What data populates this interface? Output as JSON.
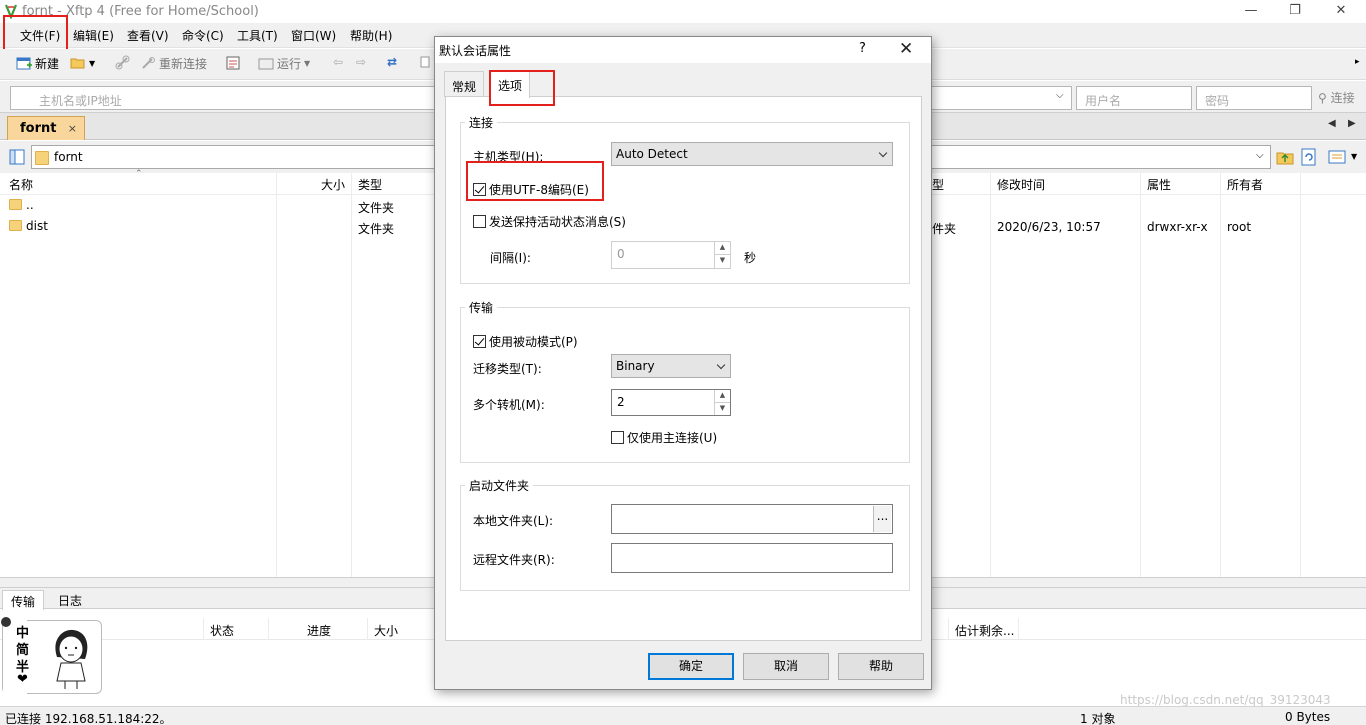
{
  "window": {
    "title": "fornt - Xftp 4 (Free for Home/School)",
    "controls": {
      "minimize": "—",
      "maximize": "❐",
      "close": "✕"
    }
  },
  "menu": [
    "文件(F)",
    "编辑(E)",
    "查看(V)",
    "命令(C)",
    "工具(T)",
    "窗口(W)",
    "帮助(H)"
  ],
  "toolbar": {
    "new": "新建",
    "reconnect": "重新连接",
    "run": "运行"
  },
  "address": {
    "host_placeholder": "主机名或IP地址",
    "user_placeholder": "用户名",
    "password_placeholder": "密码",
    "connect": "连接"
  },
  "session_tab": {
    "label": "fornt",
    "close": "×"
  },
  "path": "fornt",
  "left_pane": {
    "columns": [
      "名称",
      "大小",
      "类型"
    ],
    "rows": [
      {
        "name": "..",
        "size": "",
        "type": "文件夹"
      },
      {
        "name": "dist",
        "size": "",
        "type": "文件夹"
      }
    ]
  },
  "right_pane": {
    "columns": [
      "型",
      "修改时间",
      "属性",
      "所有者"
    ],
    "rows": [
      {
        "type": "件夹",
        "modified": "2020/6/23, 10:57",
        "attributes": "drwxr-xr-x",
        "owner": "root"
      }
    ]
  },
  "bottom_tabs": [
    "传输",
    "日志"
  ],
  "transfer_columns": [
    "状态",
    "进度",
    "大小",
    "估计剩余..."
  ],
  "sticker_chars": [
    "中",
    "简",
    "半",
    "❤"
  ],
  "status": {
    "connection": "已连接 192.168.51.184:22。",
    "objects": "1 对象",
    "bytes": "0 Bytes"
  },
  "watermark": "https://blog.csdn.net/qq_39123043",
  "dialog": {
    "title": "默认会话属性",
    "help": "?",
    "close": "✕",
    "tabs": [
      "常规",
      "选项"
    ],
    "connection": {
      "group": "连接",
      "host_type_label": "主机类型(H):",
      "host_type_value": "Auto Detect",
      "utf8_label": "使用UTF-8编码(E)",
      "utf8_checked": true,
      "keepalive_label": "发送保持活动状态消息(S)",
      "keepalive_checked": false,
      "interval_label": "间隔(I):",
      "interval_value": "0",
      "interval_unit": "秒"
    },
    "transfer": {
      "group": "传输",
      "passive_label": "使用被动模式(P)",
      "passive_checked": true,
      "mode_label": "迁移类型(T):",
      "mode_value": "Binary",
      "multi_label": "多个转机(M):",
      "multi_value": "2",
      "primary_only_label": "仅使用主连接(U)",
      "primary_only_checked": false
    },
    "startup": {
      "group": "启动文件夹",
      "local_label": "本地文件夹(L):",
      "local_value": "",
      "browse": "...",
      "remote_label": "远程文件夹(R):",
      "remote_value": ""
    },
    "buttons": {
      "ok": "确定",
      "cancel": "取消",
      "help": "帮助"
    }
  },
  "colors": {
    "highlight_red": "#e3201b",
    "tab_orange": "#f9d79c",
    "default_button_border": "#0078d7"
  }
}
